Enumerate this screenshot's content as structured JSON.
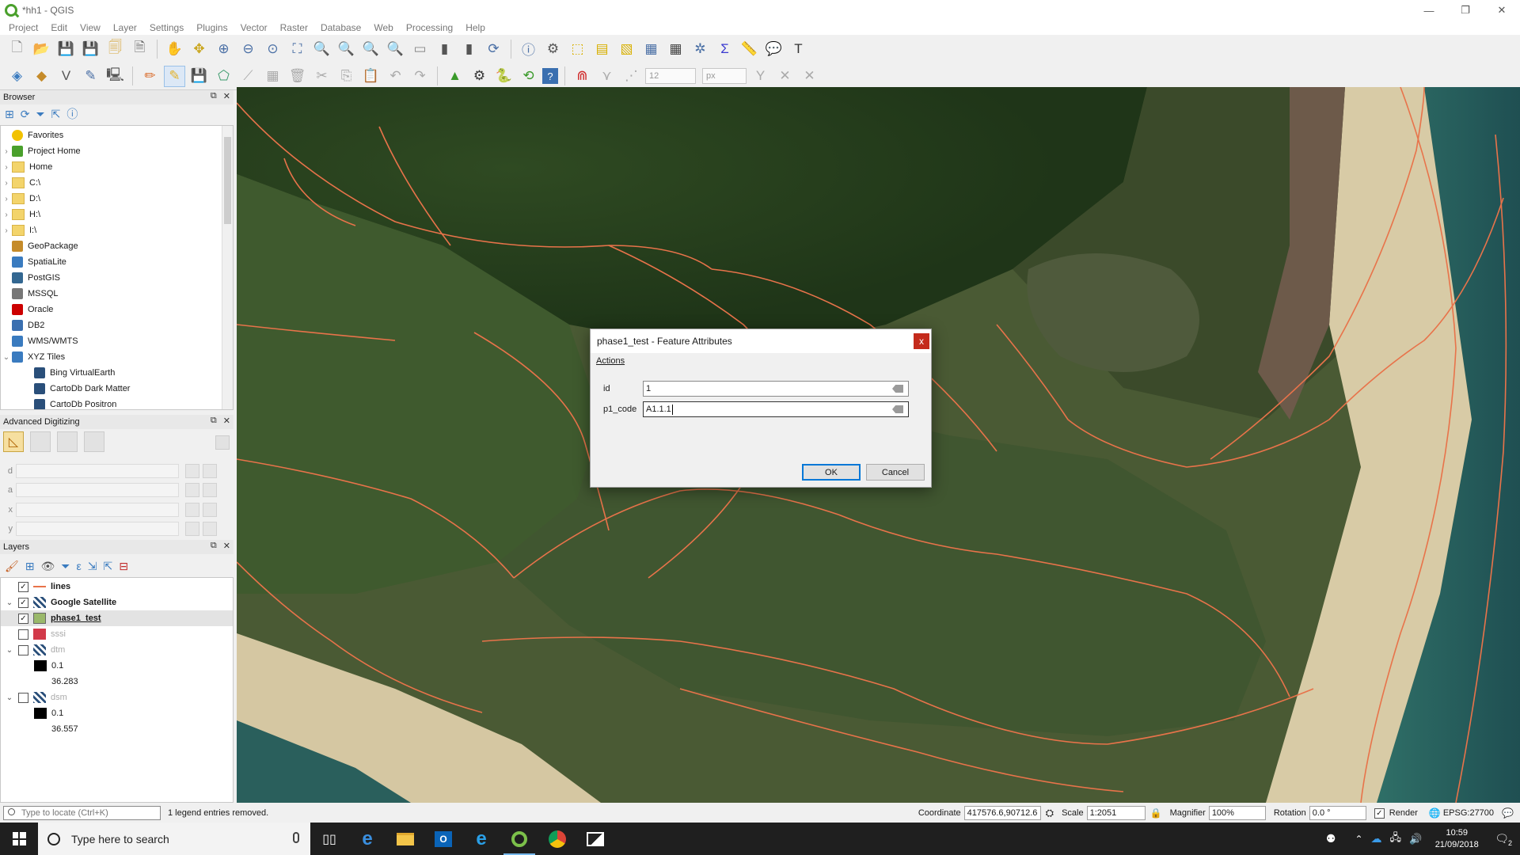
{
  "window": {
    "title": "*hh1 - QGIS",
    "controls": [
      "—",
      "❐",
      "✕"
    ]
  },
  "menu": [
    "Project",
    "Edit",
    "View",
    "Layer",
    "Settings",
    "Plugins",
    "Vector",
    "Raster",
    "Database",
    "Web",
    "Processing",
    "Help"
  ],
  "toolbar": {
    "snap_tolerance": "12",
    "snap_unit": "px"
  },
  "browser": {
    "title": "Browser",
    "items": [
      {
        "label": "Favorites",
        "icon": "star-icon",
        "arrow": ""
      },
      {
        "label": "Project Home",
        "icon": "project-home-icon",
        "arrow": "›"
      },
      {
        "label": "Home",
        "icon": "folder-icon",
        "arrow": "›"
      },
      {
        "label": "C:\\",
        "icon": "folder-icon",
        "arrow": "›"
      },
      {
        "label": "D:\\",
        "icon": "folder-icon",
        "arrow": "›"
      },
      {
        "label": "H:\\",
        "icon": "folder-icon",
        "arrow": "›"
      },
      {
        "label": "I:\\",
        "icon": "folder-icon",
        "arrow": "›"
      },
      {
        "label": "GeoPackage",
        "icon": "geopackage-icon",
        "arrow": ""
      },
      {
        "label": "SpatiaLite",
        "icon": "spatialite-icon",
        "arrow": ""
      },
      {
        "label": "PostGIS",
        "icon": "postgis-icon",
        "arrow": ""
      },
      {
        "label": "MSSQL",
        "icon": "mssql-icon",
        "arrow": ""
      },
      {
        "label": "Oracle",
        "icon": "oracle-icon",
        "arrow": ""
      },
      {
        "label": "DB2",
        "icon": "db2-icon",
        "arrow": ""
      },
      {
        "label": "WMS/WMTS",
        "icon": "wms-icon",
        "arrow": ""
      },
      {
        "label": "XYZ Tiles",
        "icon": "xyz-tiles-icon",
        "arrow": "⌄"
      },
      {
        "label": "Bing VirtualEarth",
        "icon": "tile-icon",
        "arrow": "",
        "indent": true
      },
      {
        "label": "CartoDb Dark Matter",
        "icon": "tile-icon",
        "arrow": "",
        "indent": true
      },
      {
        "label": "CartoDb Positron",
        "icon": "tile-icon",
        "arrow": "",
        "indent": true
      }
    ]
  },
  "advanced_digitizing": {
    "title": "Advanced Digitizing",
    "fields": [
      {
        "label": "d"
      },
      {
        "label": "a"
      },
      {
        "label": "x"
      },
      {
        "label": "y"
      }
    ]
  },
  "layers": {
    "title": "Layers",
    "items": [
      {
        "label": "lines",
        "checked": true,
        "bold": true,
        "arrow": "",
        "swatch": "line"
      },
      {
        "label": "Google Satellite",
        "checked": true,
        "bold": true,
        "arrow": "⌄",
        "swatch": "raster"
      },
      {
        "label": "phase1_test",
        "checked": true,
        "bold": true,
        "underline": true,
        "arrow": "",
        "swatch": "polygon",
        "selected": true
      },
      {
        "label": "sssi",
        "checked": false,
        "bold": false,
        "grey": true,
        "arrow": "",
        "swatch": "red"
      },
      {
        "label": "dtm",
        "checked": false,
        "grey": true,
        "arrow": "⌄",
        "swatch": "raster"
      },
      {
        "label": "0.1",
        "legend": true,
        "swatch": "black"
      },
      {
        "label": "36.283",
        "legend": true,
        "swatch": "none"
      },
      {
        "label": "dsm",
        "checked": false,
        "grey": true,
        "arrow": "⌄",
        "swatch": "raster"
      },
      {
        "label": "0.1",
        "legend": true,
        "swatch": "black"
      },
      {
        "label": "36.557",
        "legend": true,
        "swatch": "none"
      }
    ]
  },
  "dialog": {
    "title": "phase1_test - Feature Attributes",
    "close": "x",
    "actions": "Actions",
    "fields": [
      {
        "label": "id",
        "value": "1"
      },
      {
        "label": "p1_code",
        "value": "A1.1.1"
      }
    ],
    "ok": "OK",
    "cancel": "Cancel"
  },
  "statusbar": {
    "locator_placeholder": "Type to locate (Ctrl+K)",
    "message": "1 legend entries removed.",
    "coordinate_label": "Coordinate",
    "coordinate": "417576.6,90712.6",
    "scale_label": "Scale",
    "scale": "1:2051",
    "magnifier_label": "Magnifier",
    "magnifier": "100%",
    "rotation_label": "Rotation",
    "rotation": "0.0 °",
    "render_label": "Render",
    "crs": "EPSG:27700"
  },
  "taskbar": {
    "search_placeholder": "Type here to search",
    "time": "10:59",
    "date": "21/09/2018",
    "notifications": "2"
  },
  "colors": {
    "vector_lines": "#e8734a",
    "accent": "#0078d7",
    "close_red": "#c42b1c"
  }
}
